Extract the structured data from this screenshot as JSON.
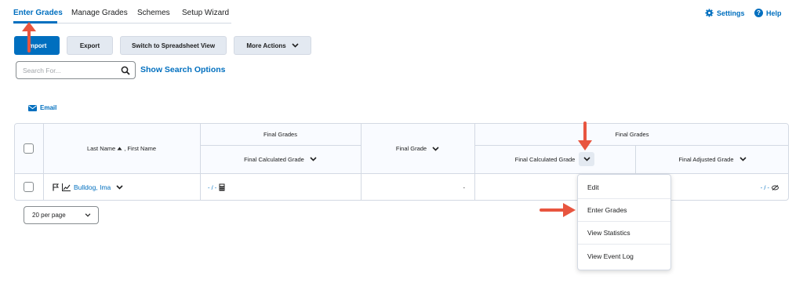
{
  "nav": {
    "tabs": [
      "Enter Grades",
      "Manage Grades",
      "Schemes",
      "Setup Wizard"
    ],
    "active_tab": "Enter Grades",
    "settings": "Settings",
    "help": "Help"
  },
  "toolbar": {
    "import": "Import",
    "export": "Export",
    "spreadsheet": "Switch to Spreadsheet View",
    "more_actions": "More Actions"
  },
  "search": {
    "placeholder": "Search For...",
    "show_options": "Show Search Options"
  },
  "email_label": "Email",
  "grid": {
    "name_header": "Last Name",
    "name_header_suffix": ", First Name",
    "group1": {
      "title": "Final Grades",
      "sub": "Final Calculated Grade"
    },
    "final_grade": "Final Grade",
    "group2": {
      "title": "Final Grades",
      "sub1": "Final Calculated Grade",
      "sub2": "Final Adjusted Grade"
    },
    "row": {
      "name": "Bulldog, Ima",
      "calc_grade": "- / -",
      "final_grade": "-",
      "adjusted_grade": "- / -"
    }
  },
  "pagination": {
    "per_page": "20 per page"
  },
  "menu": {
    "items": [
      "Edit",
      "Enter Grades",
      "View Statistics",
      "View Event Log"
    ]
  },
  "colors": {
    "brand": "#006fbf",
    "arrow": "#e8553f",
    "border": "#d3d9e3"
  }
}
